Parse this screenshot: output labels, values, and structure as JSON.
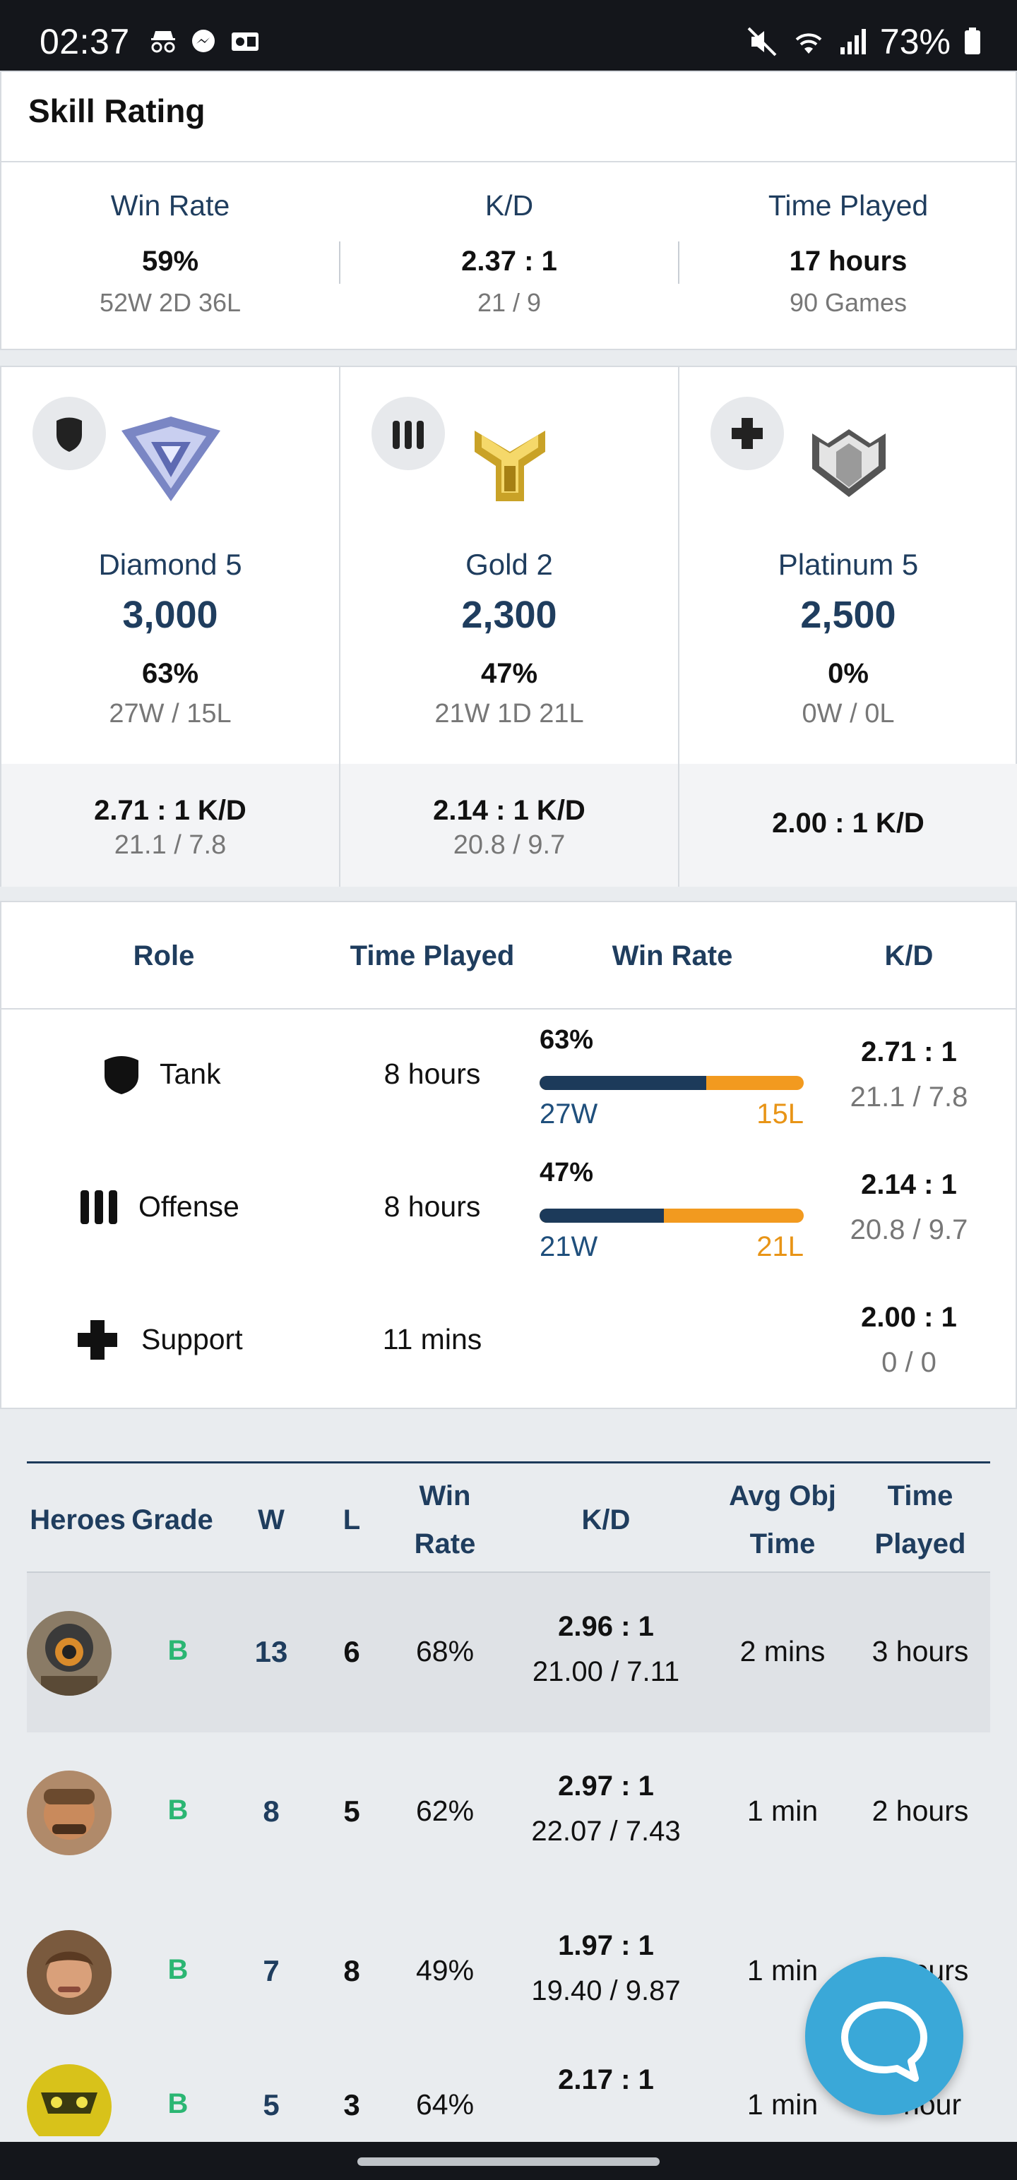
{
  "status_bar": {
    "time": "02:37",
    "battery": "73%"
  },
  "page": {
    "title": "Skill Rating"
  },
  "summary": [
    {
      "label": "Win Rate",
      "value": "59%",
      "sub": "52W 2D 36L"
    },
    {
      "label": "K/D",
      "value": "2.37 : 1",
      "sub": "21 / 9"
    },
    {
      "label": "Time Played",
      "value": "17 hours",
      "sub": "90 Games"
    }
  ],
  "role_cards": [
    {
      "role_icon": "tank-shield-icon",
      "rank_icon": "diamond-rank-icon",
      "rank": "Diamond 5",
      "sr": "3,000",
      "pct": "63%",
      "record": "27W / 15L",
      "kd": "2.71 : 1 K/D",
      "kd_detail": "21.1 / 7.8"
    },
    {
      "role_icon": "offense-bullets-icon",
      "rank_icon": "gold-rank-icon",
      "rank": "Gold 2",
      "sr": "2,300",
      "pct": "47%",
      "record": "21W 1D 21L",
      "kd": "2.14 : 1 K/D",
      "kd_detail": "20.8 / 9.7"
    },
    {
      "role_icon": "support-cross-icon",
      "rank_icon": "platinum-rank-icon",
      "rank": "Platinum 5",
      "sr": "2,500",
      "pct": "0%",
      "record": "0W / 0L",
      "kd": "2.00 : 1 K/D",
      "kd_detail": ""
    }
  ],
  "role_table": {
    "headers": {
      "role": "Role",
      "time": "Time Played",
      "winrate": "Win Rate",
      "kd": "K/D"
    },
    "rows": [
      {
        "icon": "tank-shield-icon",
        "role": "Tank",
        "time": "8 hours",
        "win_pct": "63%",
        "win_fraction": 0.63,
        "w": "27W",
        "l": "15L",
        "kd": "2.71 : 1",
        "kd_detail": "21.1 / 7.8"
      },
      {
        "icon": "offense-bullets-icon",
        "role": "Offense",
        "time": "8 hours",
        "win_pct": "47%",
        "win_fraction": 0.47,
        "w": "21W",
        "l": "21L",
        "kd": "2.14 : 1",
        "kd_detail": "20.8 / 9.7"
      },
      {
        "icon": "support-cross-icon",
        "role": "Support",
        "time": "11 mins",
        "win_pct": "",
        "w": "",
        "l": "",
        "kd": "2.00 : 1",
        "kd_detail": "0 / 0"
      }
    ]
  },
  "heroes_table": {
    "headers": {
      "heroes": "Heroes",
      "grade": "Grade",
      "w": "W",
      "l": "L",
      "winrate_1": "Win",
      "winrate_2": "Rate",
      "kd": "K/D",
      "obj_1": "Avg Obj",
      "obj_2": "Time",
      "time_1": "Time",
      "time_2": "Played"
    },
    "rows": [
      {
        "grade": "B",
        "w": "13",
        "l": "6",
        "winrate": "68%",
        "kd": "2.96 : 1",
        "kd_detail": "21.00 / 7.11",
        "obj": "2 mins",
        "time": "3 hours"
      },
      {
        "grade": "B",
        "w": "8",
        "l": "5",
        "winrate": "62%",
        "kd": "2.97 : 1",
        "kd_detail": "22.07 / 7.43",
        "obj": "1 min",
        "time": "2 hours"
      },
      {
        "grade": "B",
        "w": "7",
        "l": "8",
        "winrate": "49%",
        "kd": "1.97 : 1",
        "kd_detail": "19.40 / 9.87",
        "obj": "1 min",
        "time": "9 hours"
      },
      {
        "grade": "B",
        "w": "5",
        "l": "3",
        "winrate": "64%",
        "kd": "2.17 : 1",
        "kd_detail": "",
        "obj": "1 min",
        "time": "1 hour"
      }
    ]
  },
  "colors": {
    "navy": "#1c3a5a",
    "orange": "#f29a1f",
    "grade_green": "#2bb673",
    "fab_blue": "#3aa8d8"
  }
}
